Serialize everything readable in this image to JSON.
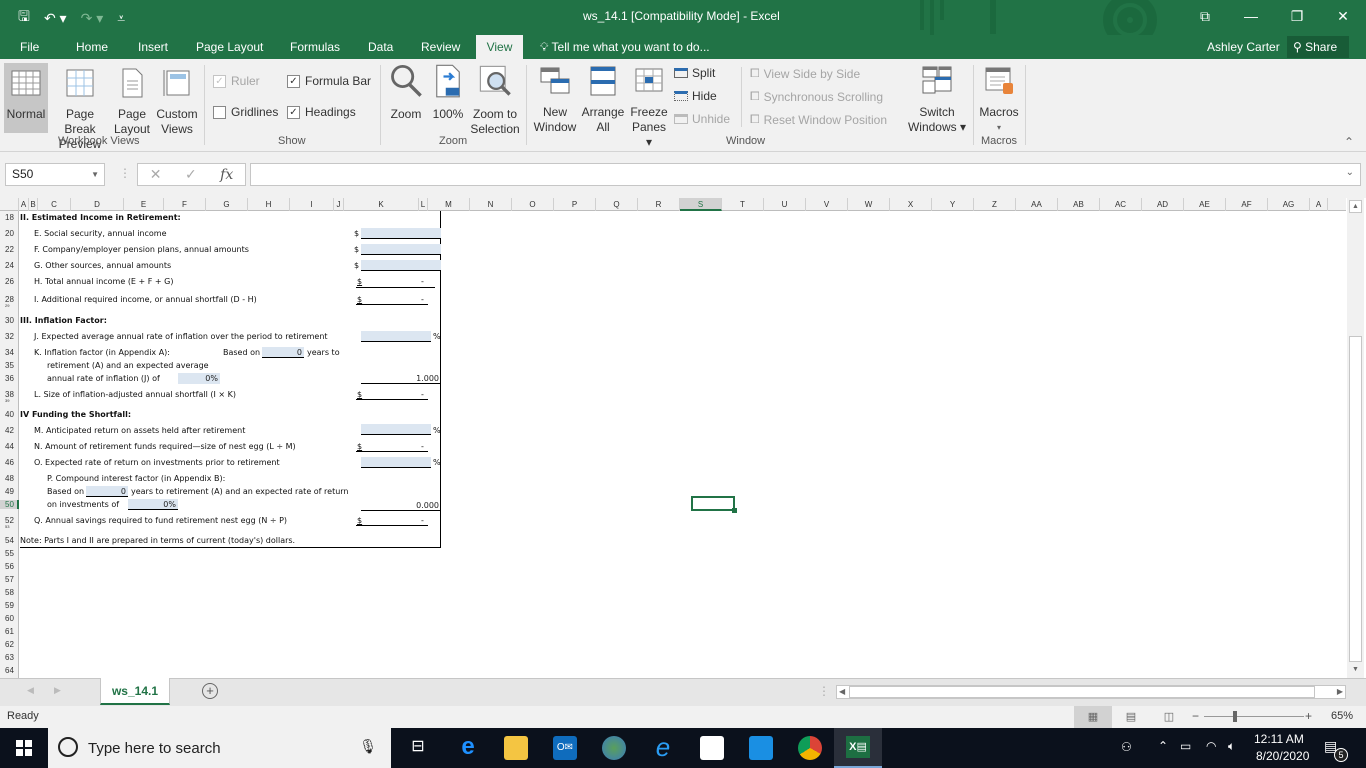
{
  "window": {
    "title": "ws_14.1  [Compatibility Mode] - Excel",
    "user": "Ashley Carter",
    "share_label": "Share"
  },
  "qat": {
    "save": "save-icon",
    "undo": "undo-icon",
    "redo": "redo-icon",
    "customize": "customize-icon"
  },
  "tabs": [
    "File",
    "Home",
    "Insert",
    "Page Layout",
    "Formulas",
    "Data",
    "Review",
    "View"
  ],
  "active_tab": "View",
  "tell_me": "Tell me what you want to do...",
  "ribbon": {
    "workbook_views": {
      "label": "Workbook Views",
      "buttons": [
        {
          "l1": "Normal",
          "l2": ""
        },
        {
          "l1": "Page Break",
          "l2": "Preview"
        },
        {
          "l1": "Page",
          "l2": "Layout"
        },
        {
          "l1": "Custom",
          "l2": "Views"
        }
      ]
    },
    "show": {
      "label": "Show",
      "ruler": {
        "label": "Ruler",
        "checked": true,
        "disabled": true
      },
      "formula_bar": {
        "label": "Formula Bar",
        "checked": true
      },
      "gridlines": {
        "label": "Gridlines",
        "checked": false
      },
      "headings": {
        "label": "Headings",
        "checked": true
      }
    },
    "zoom": {
      "label": "Zoom",
      "buttons": [
        {
          "l1": "Zoom",
          "l2": ""
        },
        {
          "l1": "100%",
          "l2": ""
        },
        {
          "l1": "Zoom to",
          "l2": "Selection"
        }
      ]
    },
    "window": {
      "label": "Window",
      "buttons": [
        {
          "l1": "New",
          "l2": "Window"
        },
        {
          "l1": "Arrange",
          "l2": "All"
        },
        {
          "l1": "Freeze",
          "l2": "Panes ▾"
        }
      ],
      "split": "Split",
      "hide": "Hide",
      "unhide": "Unhide",
      "view_side_by_side": "View Side by Side",
      "synchronous_scrolling": "Synchronous Scrolling",
      "reset_window_position": "Reset Window Position",
      "switch_windows": {
        "l1": "Switch",
        "l2": "Windows ▾"
      }
    },
    "macros": {
      "label": "Macros",
      "button": "Macros",
      "arrow": "▾"
    }
  },
  "formula_bar": {
    "name_box": "S50",
    "formula": "",
    "fx": "fx"
  },
  "columns": [
    "A",
    "B",
    "C",
    "D",
    "E",
    "F",
    "G",
    "H",
    "I",
    "J",
    "K",
    "L",
    "M",
    "N",
    "O",
    "P",
    "Q",
    "R",
    "S",
    "T",
    "U",
    "V",
    "W",
    "X",
    "Y",
    "Z",
    "AA",
    "AB",
    "AC",
    "AD",
    "AE",
    "AF",
    "AG",
    "A"
  ],
  "selected_column": "S",
  "rows": [
    "18",
    "20",
    "22",
    "24",
    "26",
    "28",
    "29",
    "30",
    "32",
    "34",
    "35",
    "36",
    "38",
    "39",
    "40",
    "42",
    "44",
    "46",
    "48",
    "49",
    "50",
    "52",
    "53",
    "54",
    "55",
    "56",
    "57",
    "58",
    "59",
    "60",
    "61",
    "62",
    "63",
    "64"
  ],
  "selected_row": "50",
  "worksheet": {
    "sec2": "II.  Estimated Income in Retirement:",
    "e": "E.  Social security, annual income",
    "f": "F.  Company/employer pension plans, annual amounts",
    "g": "G.  Other sources, annual amounts",
    "h": "H.  Total annual income (E + F + G)",
    "i": "I.   Additional required income, or annual shortfall (D - H)",
    "sec3": "III. Inflation Factor:",
    "j": "J.  Expected average annual rate of inflation over the period to retirement",
    "k1": "K.  Inflation factor (in Appendix A):",
    "k_based": "Based on",
    "k_years_val": "0",
    "k_years": "years to",
    "k2": "retirement (A) and an expected average",
    "k3": "annual rate of inflation (J) of",
    "k_rate": "0%",
    "k_factor": "1.000",
    "l": "L.  Size of inflation-adjusted annual shortfall (I × K)",
    "sec4": "IV  Funding the Shortfall:",
    "m": "M. Anticipated return on assets held after retirement",
    "n": "N.  Amount of retirement funds required—size of nest egg (L ÷ M)",
    "o": "O.  Expected rate of return on investments prior to retirement",
    "p1": "P.  Compound interest factor (in Appendix B):",
    "p_based": "Based on",
    "p_years_val": "0",
    "p2": "years to retirement (A) and an expected rate of return",
    "p3": "on investments of",
    "p_rate": "0%",
    "p_factor": "0.000",
    "q": "Q.  Annual savings required to fund retirement nest egg (N ÷ P)",
    "note": "Note: Parts I and II are prepared in terms of current (today's) dollars.",
    "dollar": "$",
    "dash": "-",
    "pct": "%"
  },
  "sheet_tabs": [
    "ws_14.1"
  ],
  "status": {
    "ready": "Ready",
    "zoom": "65%"
  },
  "taskbar": {
    "search_placeholder": "Type here to search",
    "time": "12:11 AM",
    "date": "8/20/2020",
    "notifications": "5"
  }
}
